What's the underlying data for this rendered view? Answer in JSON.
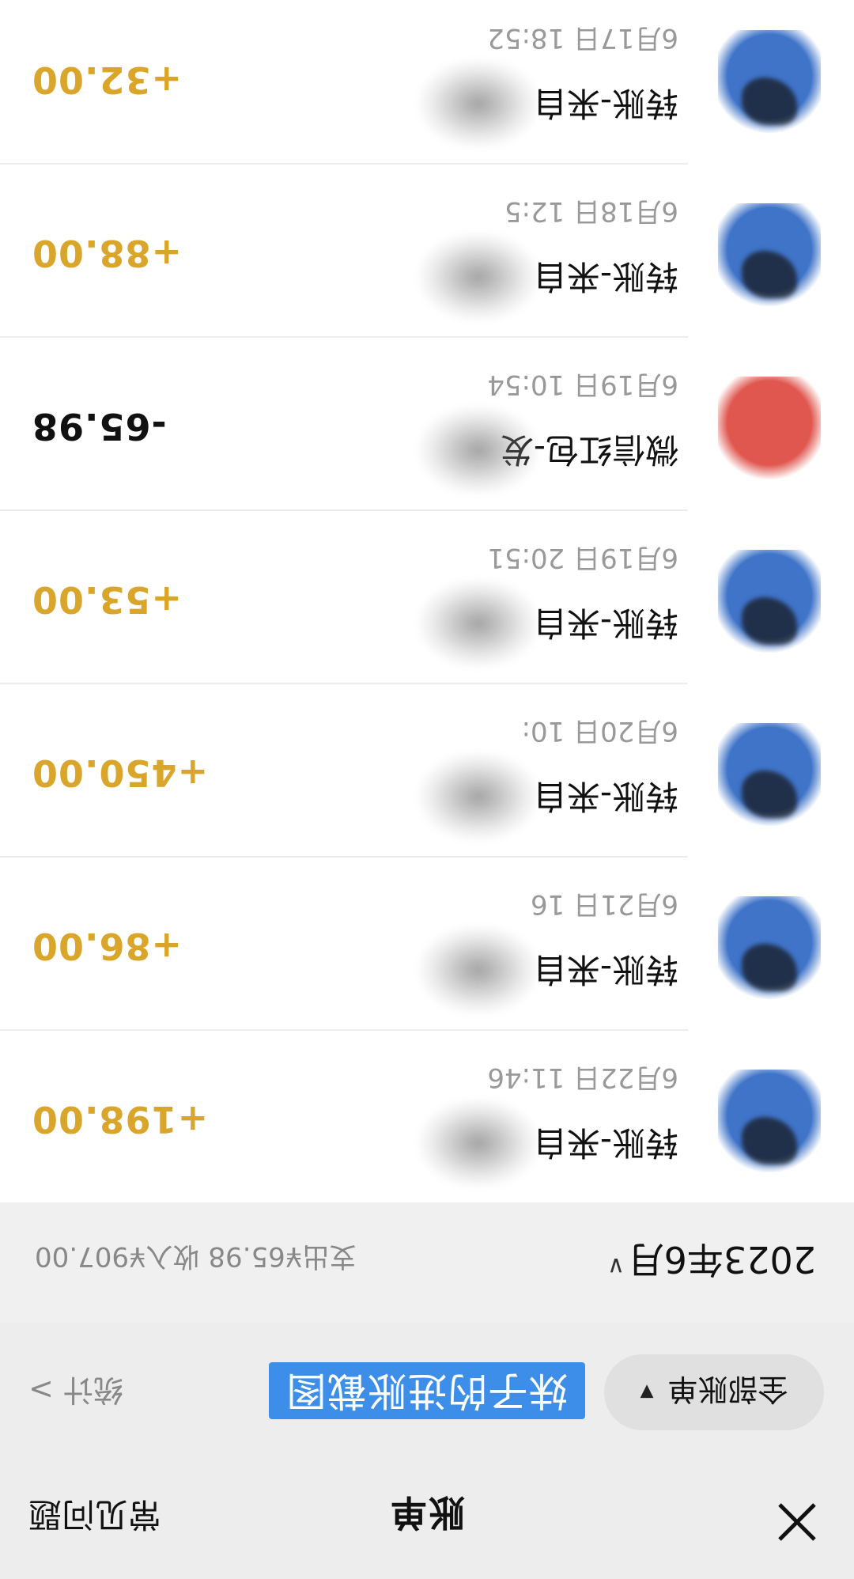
{
  "nav": {
    "title": "账单",
    "faq": "常见问题",
    "close_icon": "close-icon"
  },
  "toolbar": {
    "filter_label": "全部账单",
    "filter_caret": "▼",
    "banner_text": "妹子的进账截图",
    "stats_label": "统计 >"
  },
  "month": {
    "label": "2023年6月",
    "chevron": "∨",
    "summary": "支出¥65.98 收入¥907.00"
  },
  "colors": {
    "income": "#d9a62b",
    "expense": "#111111",
    "banner": "#3d8ee8",
    "avatar_blue": "#3f74c9",
    "avatar_red": "#e0574f"
  },
  "transactions": [
    {
      "title": "转账-来自",
      "time": "6月22日 11:46",
      "amount": "+198.00",
      "type": "income",
      "avatar": "blue"
    },
    {
      "title": "转账-来自",
      "time": "6月21日 16",
      "amount": "+86.00",
      "type": "income",
      "avatar": "blue"
    },
    {
      "title": "转账-来自",
      "time": "6月20日 10:",
      "amount": "+450.00",
      "type": "income",
      "avatar": "blue"
    },
    {
      "title": "转账-来自",
      "time": "6月19日 20:51",
      "amount": "+53.00",
      "type": "income",
      "avatar": "blue"
    },
    {
      "title": "微信红包-发",
      "time": "6月19日 10:54",
      "amount": "-65.98",
      "type": "expense",
      "avatar": "red"
    },
    {
      "title": "转账-来自",
      "time": "6月18日 12:5",
      "amount": "+88.00",
      "type": "income",
      "avatar": "blue"
    },
    {
      "title": "转账-来自",
      "time": "6月17日 18:52",
      "amount": "+32.00",
      "type": "income",
      "avatar": "blue"
    }
  ]
}
